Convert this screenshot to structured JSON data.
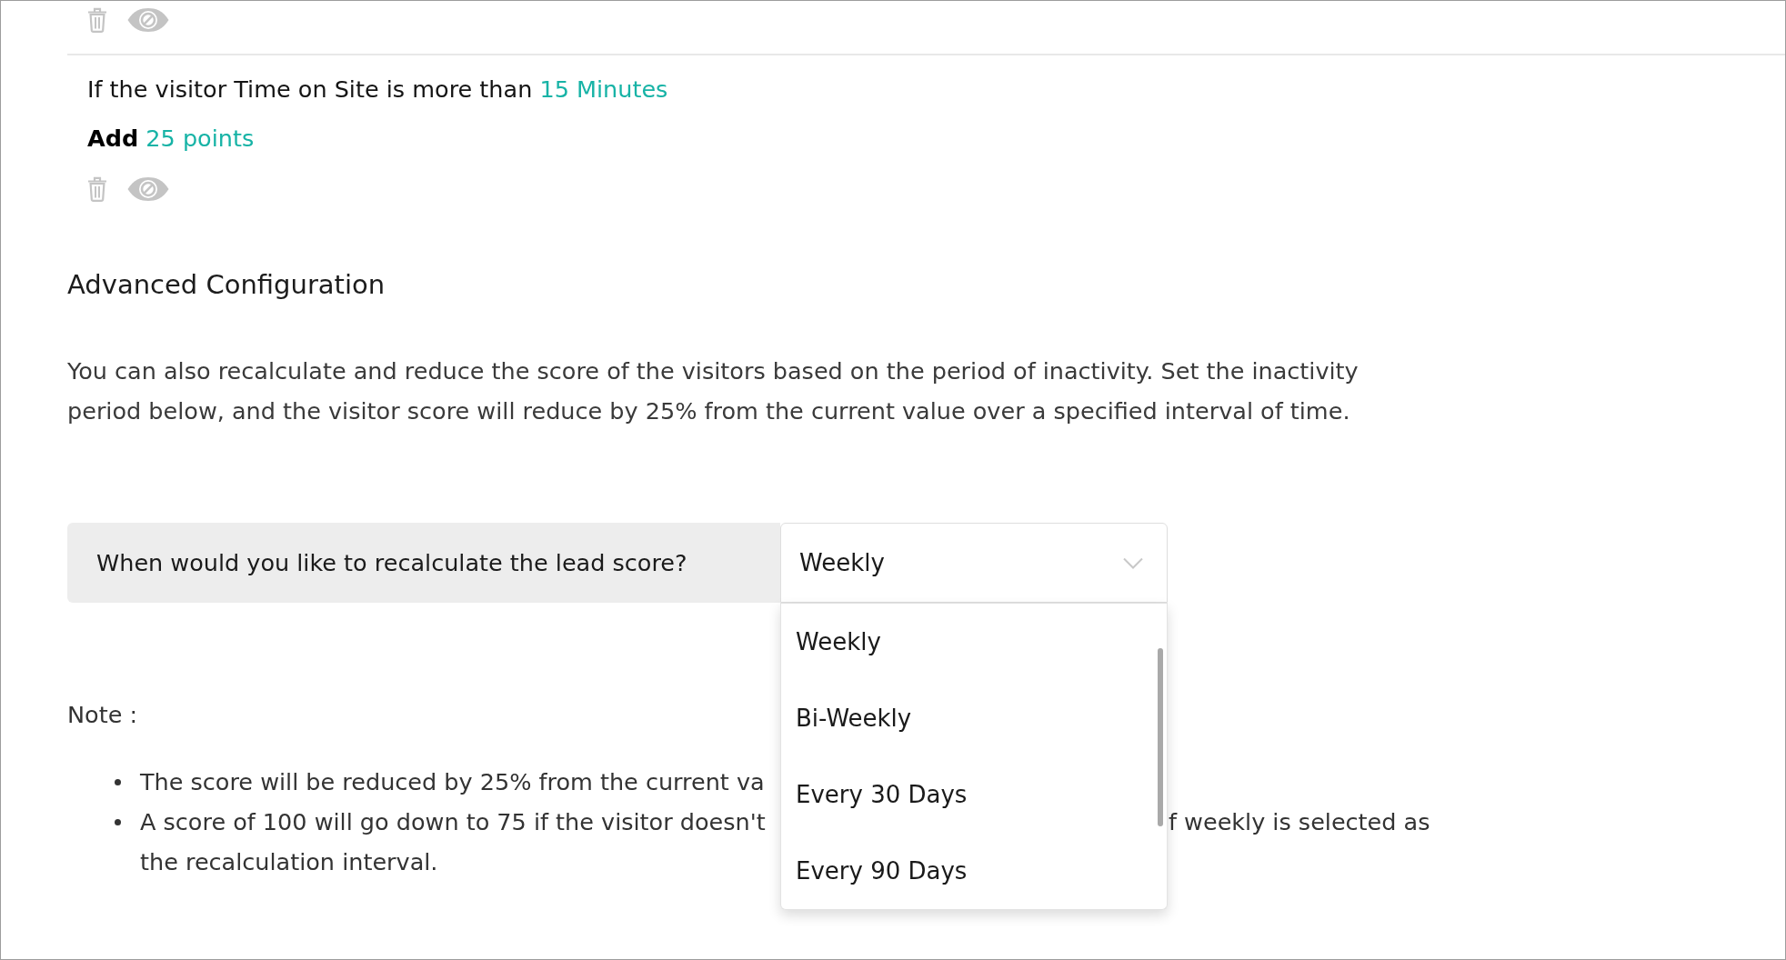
{
  "rule": {
    "condition": "If the visitor Time on Site is more than",
    "condition_value": "15 Minutes",
    "action": "Add",
    "action_value": "25 points"
  },
  "advanced": {
    "heading": "Advanced Configuration",
    "description": "You can also recalculate and reduce the score of the visitors based on the period of inactivity. Set the inactivity period below, and the visitor score will reduce by 25% from the current value over a specified interval of time."
  },
  "recalculation": {
    "question": "When would you like to recalculate the lead score?",
    "value": "Weekly",
    "expanded": true,
    "options": [
      "Weekly",
      "Bi-Weekly",
      "Every 30 Days",
      "Every 90 Days"
    ]
  },
  "note": {
    "label": "Note :",
    "items": [
      {
        "lines": [
          {
            "visible_left": "The score will be reduced by 25% from the current va"
          }
        ]
      },
      {
        "lines": [
          {
            "visible_left": "A score of 100 will go down to 75 if the visitor doesn't",
            "visible_right": "f weekly is selected as"
          },
          {
            "visible_left": "the recalculation interval."
          }
        ]
      }
    ]
  }
}
